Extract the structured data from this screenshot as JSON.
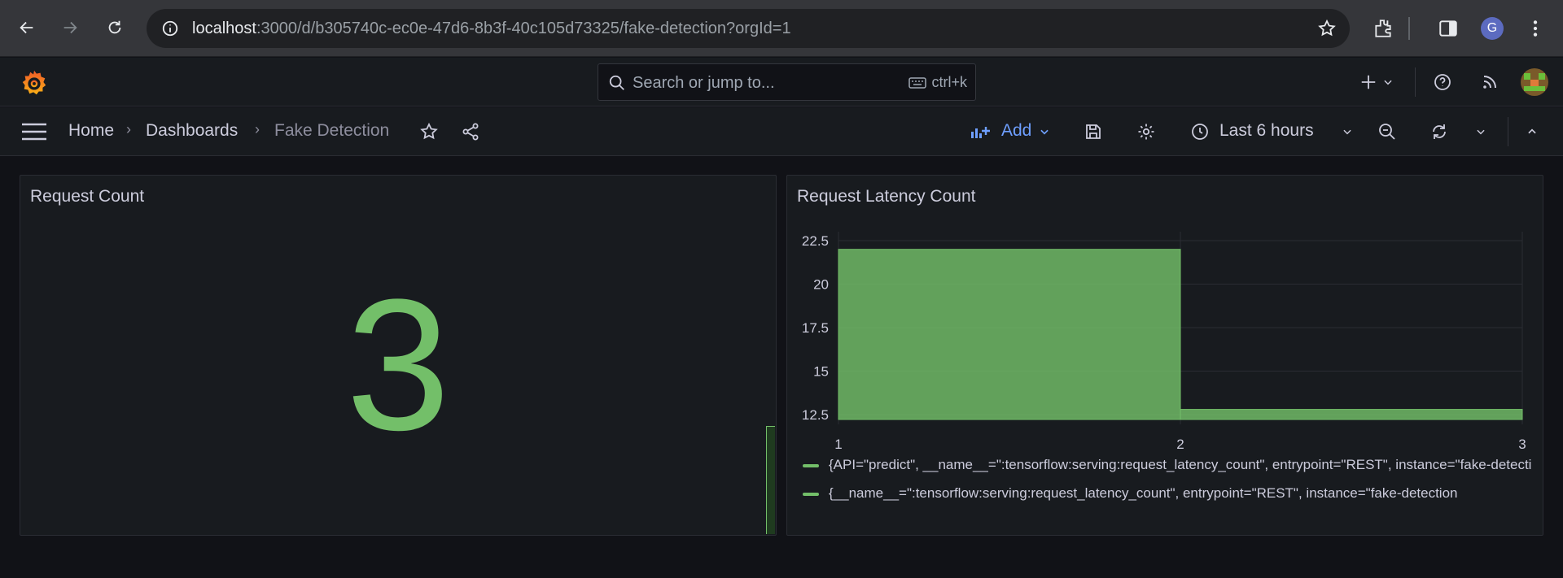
{
  "browser": {
    "url_host": "localhost",
    "url_path": ":3000/d/b305740c-ec0e-47d6-8b3f-40c105d73325/fake-detection?orgId=1",
    "profile_initial": "G"
  },
  "topbar": {
    "search_placeholder": "Search or jump to...",
    "search_shortcut": "ctrl+k"
  },
  "breadcrumb": {
    "home": "Home",
    "dashboards": "Dashboards",
    "current": "Fake Detection"
  },
  "toolbar": {
    "add_label": "Add",
    "time_range": "Last 6 hours"
  },
  "panels": {
    "request_count": {
      "title": "Request Count",
      "value": "3"
    },
    "latency": {
      "title": "Request Latency Count",
      "legend": [
        "{API=\"predict\", __name__=\":tensorflow:serving:request_latency_count\", entrypoint=\"REST\", instance=\"fake-detection",
        "{__name__=\":tensorflow:serving:request_latency_count\", entrypoint=\"REST\", instance=\"fake-detection"
      ]
    }
  },
  "chart_data": {
    "type": "bar",
    "x_ticks": [
      "1",
      "2",
      "3"
    ],
    "y_ticks": [
      "22.5",
      "20",
      "17.5",
      "15",
      "12.5"
    ],
    "ylim": [
      11,
      23
    ],
    "xlim": [
      1,
      3
    ],
    "series": [
      {
        "x_start": 1,
        "x_end": 2,
        "value": 22
      },
      {
        "x_start": 2,
        "x_end": 3,
        "value": 12.8
      }
    ],
    "color": "#73bf69"
  },
  "colors": {
    "accent": "#6e9fff",
    "series_green": "#73bf69"
  }
}
